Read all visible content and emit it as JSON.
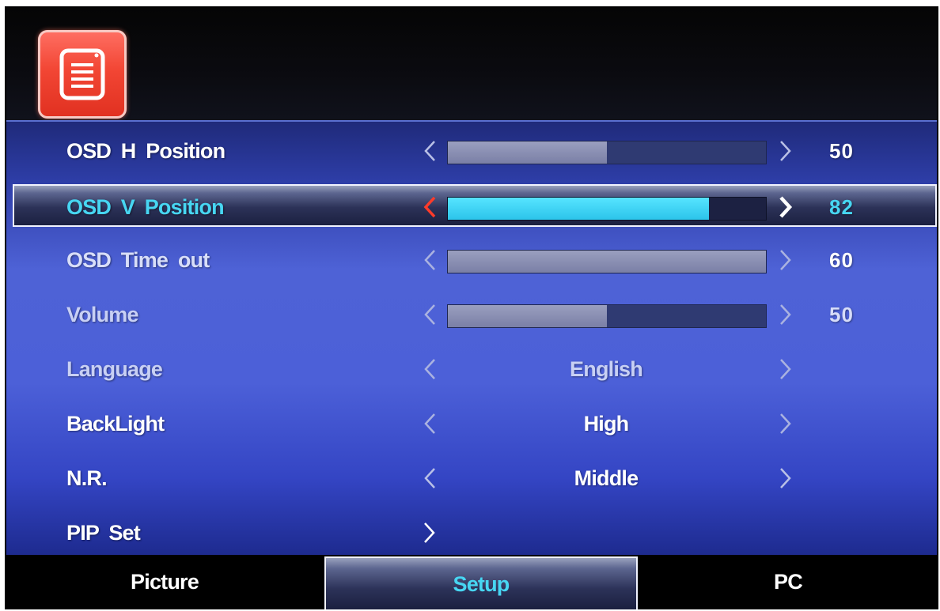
{
  "menu": {
    "items": [
      {
        "label": "OSD  H Position",
        "type": "slider",
        "value": "50",
        "level": 0.5
      },
      {
        "label": "OSD  V Position",
        "type": "slider",
        "value": "82",
        "level": 0.82,
        "selected": true
      },
      {
        "label": "OSD  Time out",
        "type": "slider",
        "value": "60",
        "level": 1.0
      },
      {
        "label": "Volume",
        "type": "slider",
        "value": "50",
        "level": 0.5
      },
      {
        "label": "Language",
        "type": "option",
        "value": "English"
      },
      {
        "label": "BackLight",
        "type": "option",
        "value": "High"
      },
      {
        "label": "N.R.",
        "type": "option",
        "value": "Middle"
      },
      {
        "label": "PIP Set",
        "type": "submenu"
      }
    ]
  },
  "tabs": {
    "picture": "Picture",
    "setup": "Setup",
    "pc": "PC",
    "active": "Setup"
  },
  "colors": {
    "highlight_text": "#47d6f2",
    "slider_fill_active": "#2cc4ea",
    "arrow_left_active": "#ff3b2a",
    "icon_red": "#f24634"
  },
  "icons": {
    "header": "setup-menu-icon",
    "left_arrow": "chevron-left-icon",
    "right_arrow": "chevron-right-icon"
  }
}
